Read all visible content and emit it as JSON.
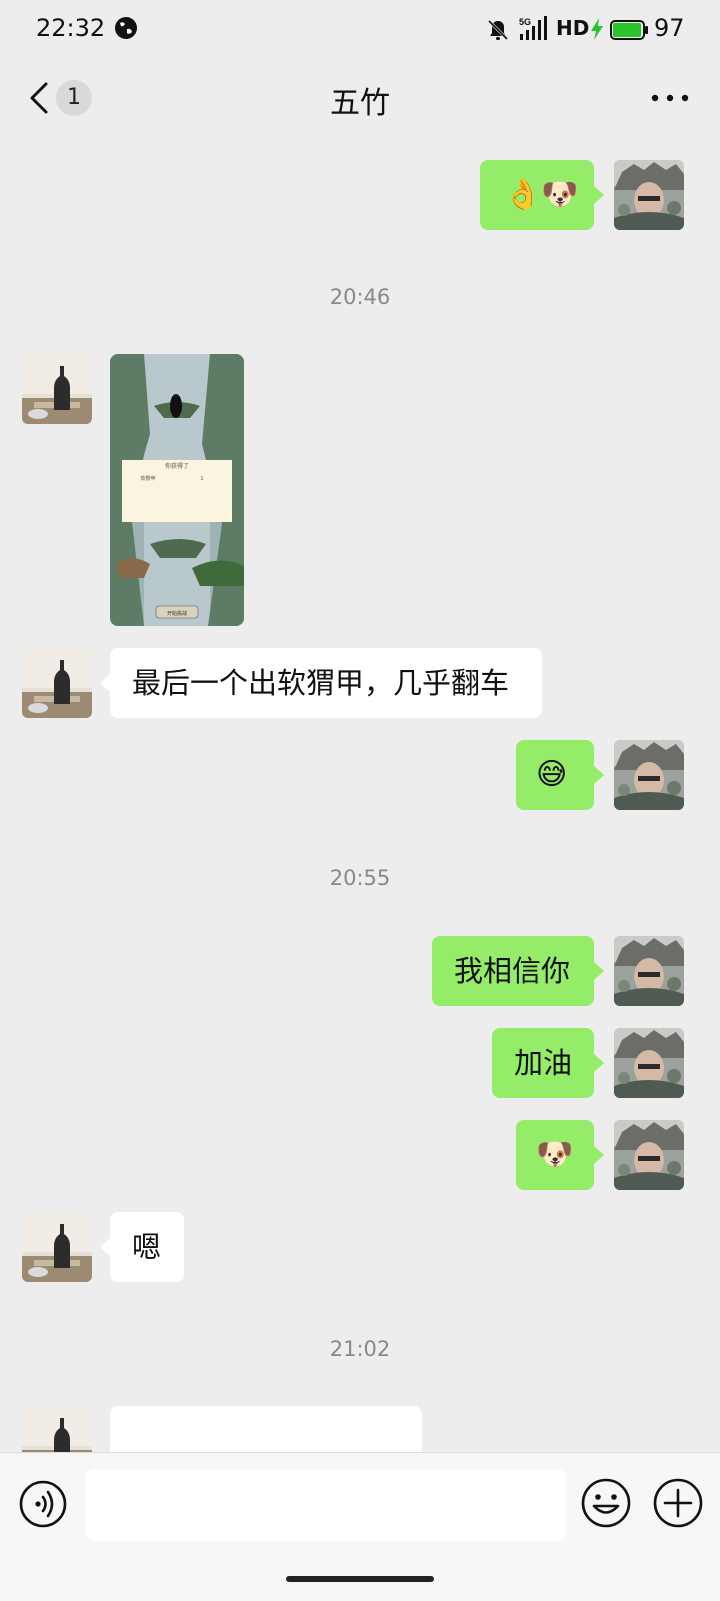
{
  "status_bar": {
    "time": "22:32",
    "network": "5G",
    "hd": "HD",
    "battery": "97",
    "battery_level": 0.97
  },
  "header": {
    "back_icon": "chevron-left-icon",
    "unread_count": "1",
    "title": "五竹",
    "more_icon": "more-dots-icon"
  },
  "messages": [
    {
      "type": "emoji",
      "from": "me",
      "content": "👌🐶"
    },
    {
      "type": "timestamp",
      "text": "20:46"
    },
    {
      "type": "image",
      "from": "other",
      "image_texts": [
        "你获得了",
        "软猬甲",
        "1",
        "开始挑战"
      ]
    },
    {
      "type": "text",
      "from": "other",
      "text": "最后一个出软猬甲，几乎翻车"
    },
    {
      "type": "emoji",
      "from": "me",
      "content": "😅"
    },
    {
      "type": "timestamp",
      "text": "20:55"
    },
    {
      "type": "text",
      "from": "me",
      "text": "我相信你"
    },
    {
      "type": "text",
      "from": "me",
      "text": "加油"
    },
    {
      "type": "emoji",
      "from": "me",
      "content": "🐶"
    },
    {
      "type": "text",
      "from": "other",
      "text": "嗯"
    },
    {
      "type": "timestamp",
      "text": "21:02"
    }
  ],
  "input_bar": {
    "voice_icon": "voice-icon",
    "emoji_icon": "emoji-icon",
    "plus_icon": "plus-circle-icon",
    "input_value": ""
  },
  "colors": {
    "background": "#ededed",
    "my_bubble": "#95ec69",
    "other_bubble": "#ffffff",
    "battery_green": "#2bc32b"
  }
}
